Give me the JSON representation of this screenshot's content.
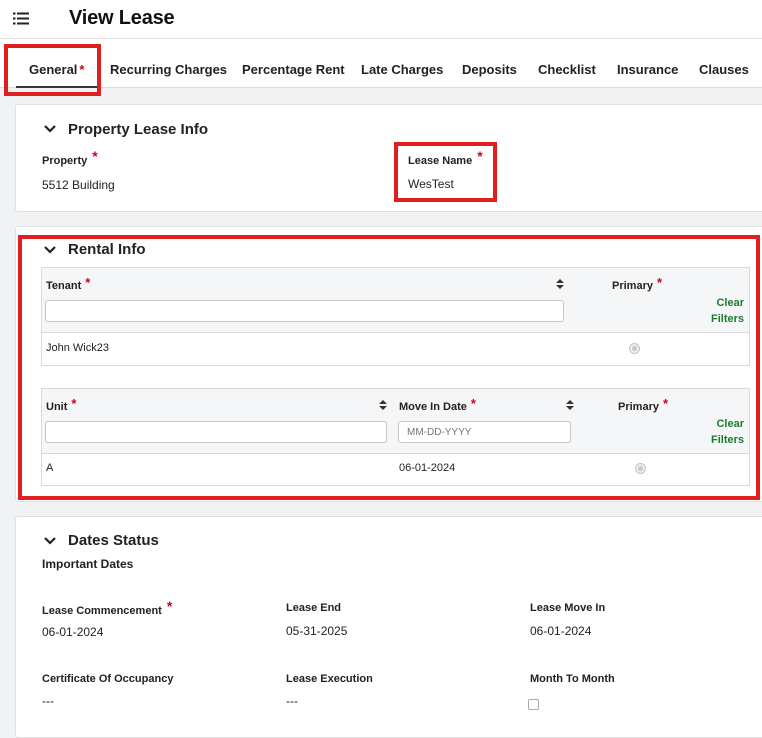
{
  "header": {
    "title": "View Lease",
    "menu_icon": "list-menu-icon"
  },
  "tabs": [
    {
      "label": "General",
      "required": "*",
      "active": true
    },
    {
      "label": "Recurring Charges"
    },
    {
      "label": "Percentage Rent"
    },
    {
      "label": "Late Charges"
    },
    {
      "label": "Deposits"
    },
    {
      "label": "Checklist"
    },
    {
      "label": "Insurance"
    },
    {
      "label": "Clauses"
    }
  ],
  "property_lease_info": {
    "title": "Property Lease Info",
    "property_label": "Property",
    "property_value": "5512 Building",
    "lease_name_label": "Lease Name",
    "lease_name_value": "WesTest"
  },
  "rental_info": {
    "title": "Rental Info",
    "tenant_grid": {
      "col_tenant": "Tenant",
      "col_primary": "Primary",
      "clear_filters": "Clear Filters",
      "rows": [
        {
          "tenant": "John Wick23"
        }
      ]
    },
    "unit_grid": {
      "col_unit": "Unit",
      "col_move_in": "Move In Date",
      "col_primary": "Primary",
      "move_in_placeholder": "MM-DD-YYYY",
      "clear_filters": "Clear Filters",
      "rows": [
        {
          "unit": "A",
          "move_in": "06-01-2024"
        }
      ]
    }
  },
  "dates_status": {
    "title": "Dates Status",
    "subtitle": "Important Dates",
    "lease_commencement_label": "Lease Commencement",
    "lease_commencement_value": "06-01-2024",
    "lease_end_label": "Lease End",
    "lease_end_value": "05-31-2025",
    "lease_move_in_label": "Lease Move In",
    "lease_move_in_value": "06-01-2024",
    "certificate_label": "Certificate Of Occupancy",
    "certificate_value": "---",
    "lease_execution_label": "Lease Execution",
    "lease_execution_value": "---",
    "month_to_month_label": "Month To Month"
  },
  "colors": {
    "required": "#d0021b",
    "link_green": "#1e7a33",
    "highlight_red": "#e02020"
  }
}
